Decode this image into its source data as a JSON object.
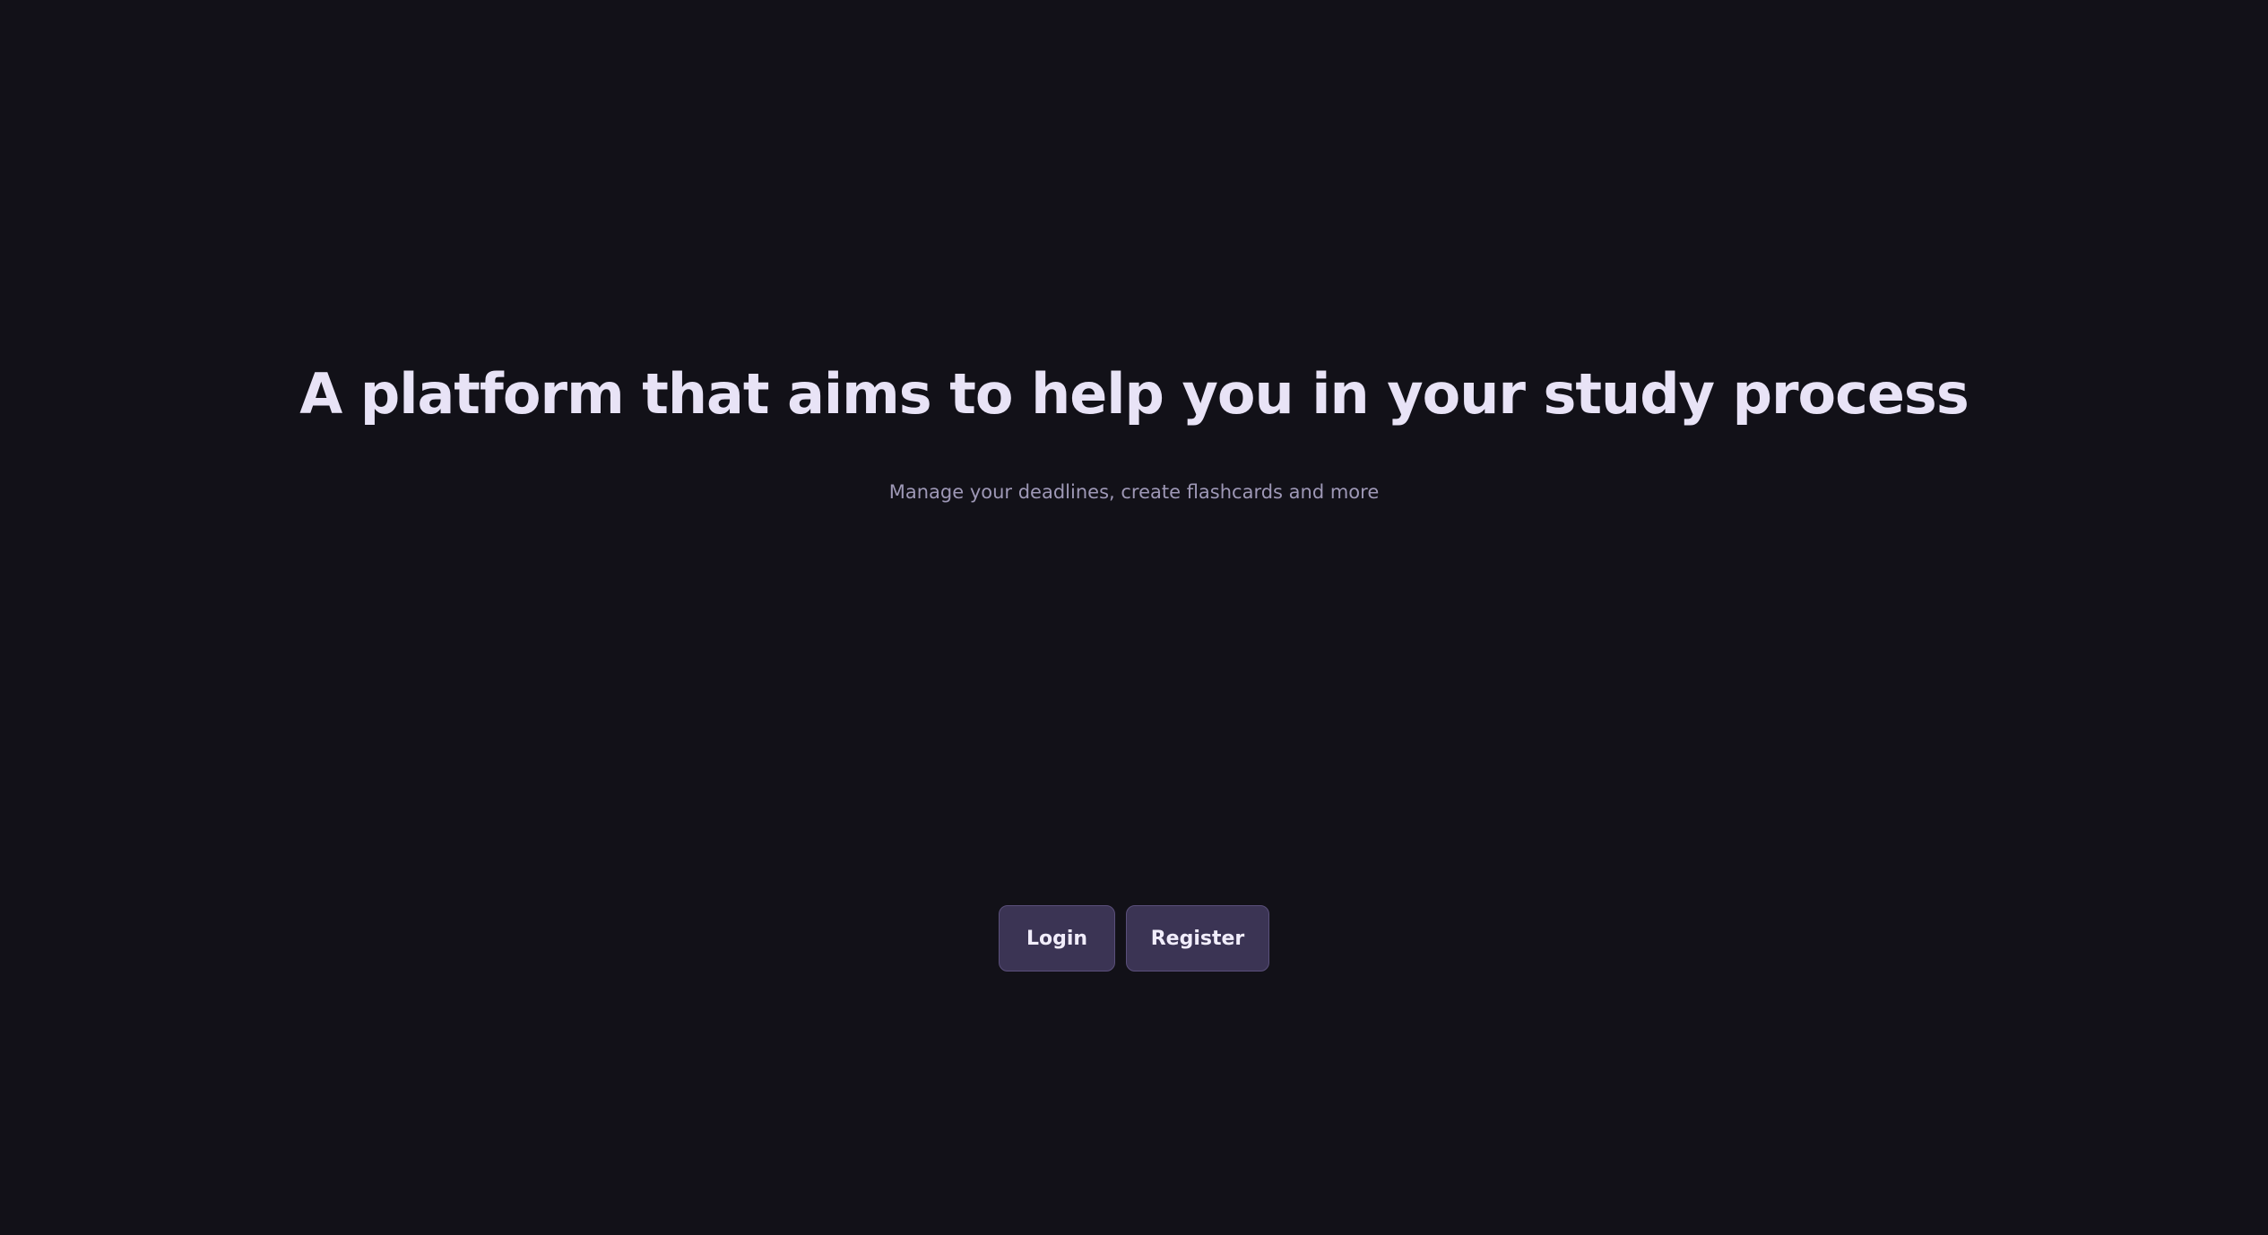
{
  "hero": {
    "headline": "A platform that aims to help you in your study process",
    "subtitle": "Manage your deadlines, create flashcards and more"
  },
  "actions": {
    "login_label": "Login",
    "register_label": "Register"
  },
  "colors": {
    "background": "#121118",
    "headline": "#e8e3f6",
    "subtitle": "#9e98b6",
    "button_bg": "#3b3454",
    "button_border": "#5a4f7a",
    "button_text": "#f1edfb"
  }
}
